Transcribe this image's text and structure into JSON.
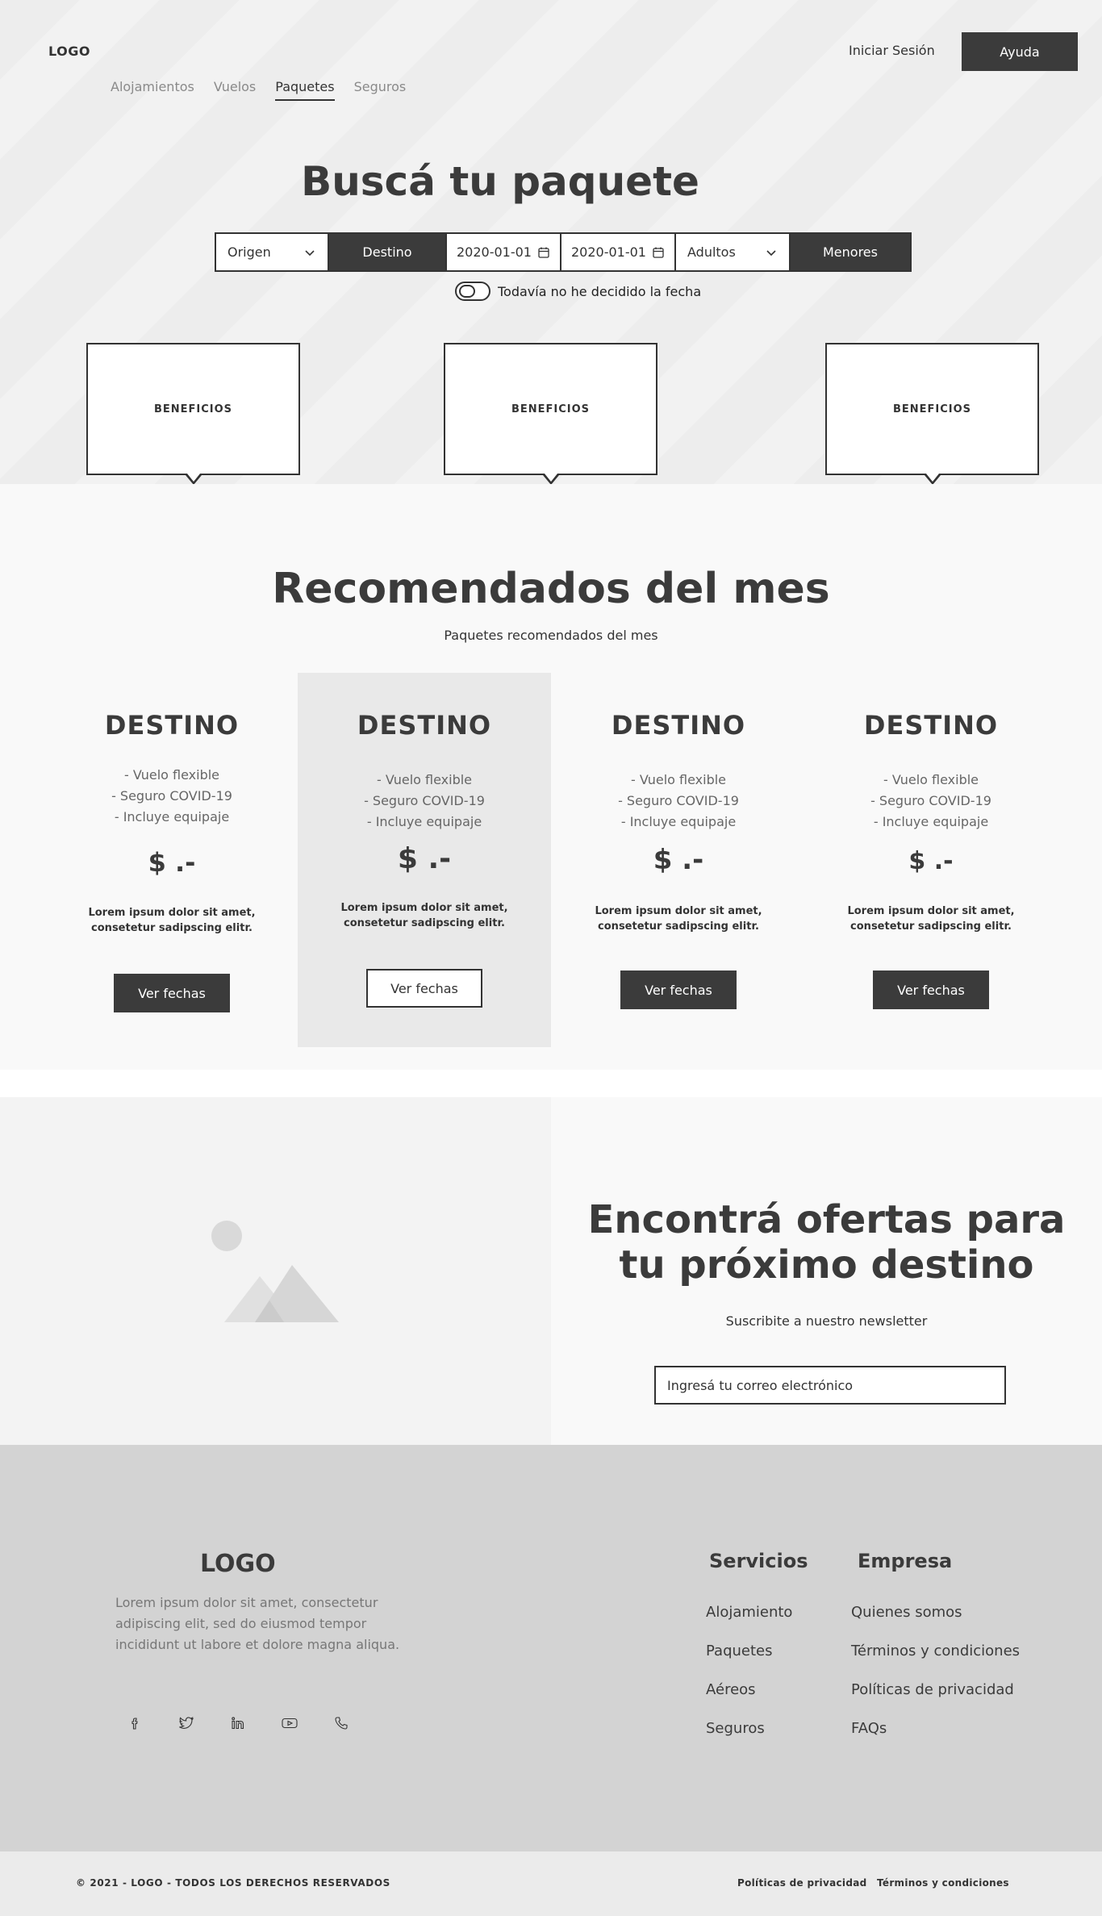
{
  "header": {
    "logo": "LOGO",
    "login": "Iniciar Sesión",
    "help": "Ayuda",
    "nav": [
      "Alojamientos",
      "Vuelos",
      "Paquetes",
      "Seguros"
    ],
    "active_nav": "Paquetes"
  },
  "hero": {
    "title": "Buscá tu paquete",
    "search": {
      "origin": "Origen",
      "destination": "Destino",
      "date_from": "2020-01-01",
      "date_to": "2020-01-01",
      "adults": "Adultos",
      "minors": "Menores"
    },
    "toggle_label": "Todavía no he decidido la fecha",
    "benefits": [
      "BENEFICIOS",
      "BENEFICIOS",
      "BENEFICIOS"
    ]
  },
  "recommended": {
    "title": "Recomendados del mes",
    "subtitle": "Paquetes recomendados del mes",
    "cards": [
      {
        "title": "DESTINO",
        "features": [
          "- Vuelo flexible",
          "- Seguro COVID-19",
          "- Incluye equipaje"
        ],
        "price": "$ .-",
        "desc_1": "Lorem ipsum dolor sit amet,",
        "desc_2": "consetetur sadipscing elitr.",
        "button": "Ver fechas"
      },
      {
        "title": "DESTINO",
        "features": [
          "- Vuelo flexible",
          "- Seguro COVID-19",
          "- Incluye equipaje"
        ],
        "price": "$ .-",
        "desc_1": "Lorem ipsum dolor sit amet,",
        "desc_2": "consetetur sadipscing elitr.",
        "button": "Ver fechas"
      },
      {
        "title": "DESTINO",
        "features": [
          "- Vuelo flexible",
          "- Seguro COVID-19",
          "- Incluye equipaje"
        ],
        "price": "$ .-",
        "desc_1": "Lorem ipsum dolor sit amet,",
        "desc_2": "consetetur sadipscing elitr.",
        "button": "Ver fechas"
      },
      {
        "title": "DESTINO",
        "features": [
          "- Vuelo flexible",
          "- Seguro COVID-19",
          "- Incluye equipaje"
        ],
        "price": "$ .-",
        "desc_1": "Lorem ipsum dolor sit amet,",
        "desc_2": "consetetur sadipscing elitr.",
        "button": "Ver fechas"
      }
    ]
  },
  "newsletter": {
    "title_1": "Encontrá ofertas para",
    "title_2": "tu próximo destino",
    "subtitle": "Suscribite a nuestro newsletter",
    "placeholder": "Ingresá tu correo electrónico",
    "image_icon": "image-placeholder-icon"
  },
  "footer": {
    "logo": "LOGO",
    "text": "Lorem ipsum dolor sit amet, consectetur adipiscing elit, sed do eiusmod tempor incididunt ut labore et dolore magna aliqua.",
    "social_icons": [
      "facebook-icon",
      "twitter-icon",
      "linkedin-icon",
      "youtube-icon",
      "phone-icon"
    ],
    "services_title": "Servicios",
    "services": [
      "Alojamiento",
      "Paquetes",
      "Aéreos",
      "Seguros"
    ],
    "company_title": "Empresa",
    "company": [
      "Quienes somos",
      "Términos y condiciones",
      "Políticas de privacidad",
      "FAQs"
    ],
    "copyright": "© 2021 - LOGO - TODOS LOS DERECHOS RESERVADOS",
    "privacy": "Políticas de privacidad",
    "terms": "Términos y condiciones"
  },
  "colors": {
    "dark": "#3b3b3b",
    "hero_bg": "#ededed",
    "section_bg": "#f9f9f9",
    "footer_bg": "#d3d3d3"
  }
}
